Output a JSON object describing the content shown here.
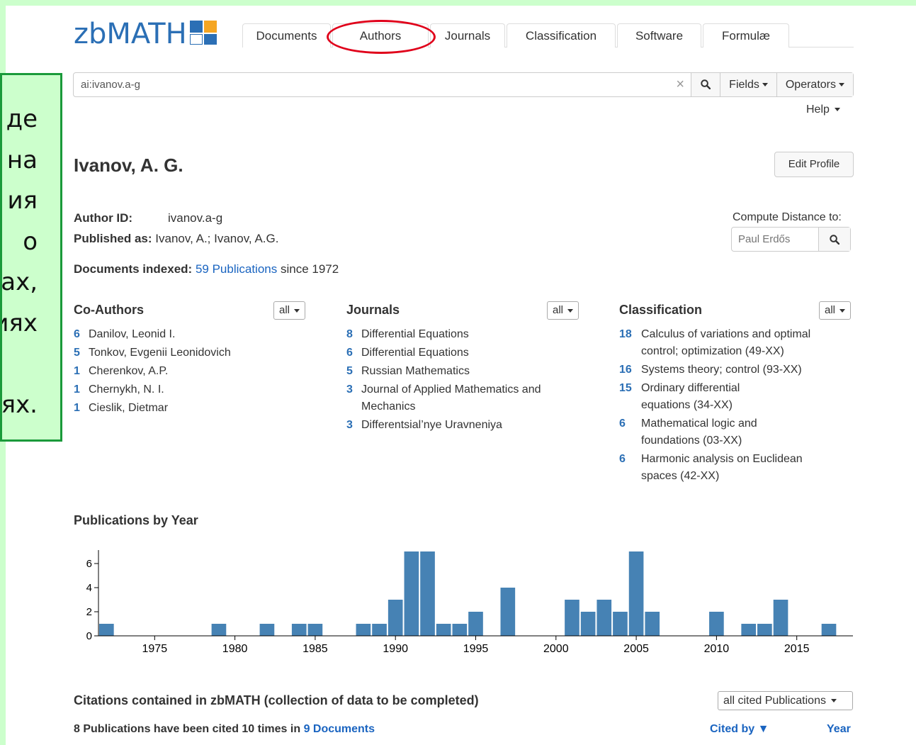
{
  "callout": {
    "lines": [
      "де",
      "на",
      "ия",
      "о",
      "ах,",
      "иях",
      "",
      "ях."
    ],
    "bg": "#ccffcc",
    "border": "#1a9a3a"
  },
  "logo": {
    "text": "zbMATH"
  },
  "nav": {
    "tabs": [
      "Documents",
      "Authors",
      "Journals",
      "Classification",
      "Software",
      "Formulæ"
    ],
    "highlighted": "Authors"
  },
  "search": {
    "value": "ai:ivanov.a-g",
    "fields_label": "Fields",
    "operators_label": "Operators",
    "help_label": "Help"
  },
  "author": {
    "name": "Ivanov, A. G.",
    "edit_label": "Edit Profile",
    "id_label": "Author ID:",
    "id_value": "ivanov.a-g",
    "published_label": "Published as:",
    "published_value": "Ivanov, A.; Ivanov, A.G.",
    "docs_label": "Documents indexed:",
    "docs_link": "59 Publications",
    "docs_since": "since 1972"
  },
  "compute": {
    "label": "Compute Distance to:",
    "placeholder": "Paul Erdős"
  },
  "coauthors": {
    "title": "Co-Authors",
    "filter": "all",
    "items": [
      {
        "count": "6",
        "name": "Danilov, Leonid I."
      },
      {
        "count": "5",
        "name": "Tonkov, Evgenii Leonidovich"
      },
      {
        "count": "1",
        "name": "Cherenkov, A.P."
      },
      {
        "count": "1",
        "name": "Chernykh, N. I."
      },
      {
        "count": "1",
        "name": "Cieslik, Dietmar"
      }
    ]
  },
  "journals": {
    "title": "Journals",
    "filter": "all",
    "items": [
      {
        "count": "8",
        "name": "Differential Equations"
      },
      {
        "count": "6",
        "name": "Differential Equations"
      },
      {
        "count": "5",
        "name": "Russian Mathematics"
      },
      {
        "count": "3",
        "name": "Journal of Applied Mathematics and Mechanics"
      },
      {
        "count": "3",
        "name": "Differentsial’nye Uravneniya"
      }
    ]
  },
  "classification": {
    "title": "Classification",
    "filter": "all",
    "items": [
      {
        "count": "18",
        "name": "Calculus of variations and optimal control; optimization (49-XX)"
      },
      {
        "count": "16",
        "name": "Systems theory; control (93-XX)"
      },
      {
        "count": "15",
        "name": "Ordinary differential equations (34-XX)"
      },
      {
        "count": "6",
        "name": "Mathematical logic and foundations (03-XX)"
      },
      {
        "count": "6",
        "name": "Harmonic analysis on Euclidean spaces (42-XX)"
      }
    ]
  },
  "chart_data": {
    "type": "bar",
    "title": "Publications by Year",
    "xlabel": "",
    "ylabel": "",
    "ylim": [
      0,
      7
    ],
    "yticks": [
      0,
      2,
      4,
      6
    ],
    "xlim": [
      1971.5,
      1918.5
    ],
    "xticks": [
      1975,
      1980,
      1985,
      1990,
      1995,
      2000,
      2005,
      2010,
      2015
    ],
    "x": [
      1972,
      1979,
      1982,
      1984,
      1985,
      1988,
      1989,
      1990,
      1991,
      1992,
      1993,
      1994,
      1995,
      1997,
      2001,
      2002,
      2003,
      2004,
      2005,
      2006,
      2010,
      2012,
      2013,
      2014,
      2017
    ],
    "values": [
      1,
      1,
      1,
      1,
      1,
      1,
      1,
      3,
      7,
      7,
      1,
      1,
      2,
      4,
      3,
      2,
      3,
      2,
      7,
      2,
      2,
      1,
      1,
      3,
      1
    ],
    "color": "#4682b4",
    "grid": false
  },
  "citations": {
    "title": "Citations contained in zbMATH (collection of data to be completed)",
    "filter": "all cited Publications",
    "summary_prefix": "8 Publications have been cited 10 times in",
    "summary_link": "9 Documents",
    "cited_by": "Cited by ▼",
    "year": "Year"
  },
  "colors": {
    "accent": "#2b6fb5",
    "link": "#1a64c0",
    "highlight": "#e0001a"
  }
}
